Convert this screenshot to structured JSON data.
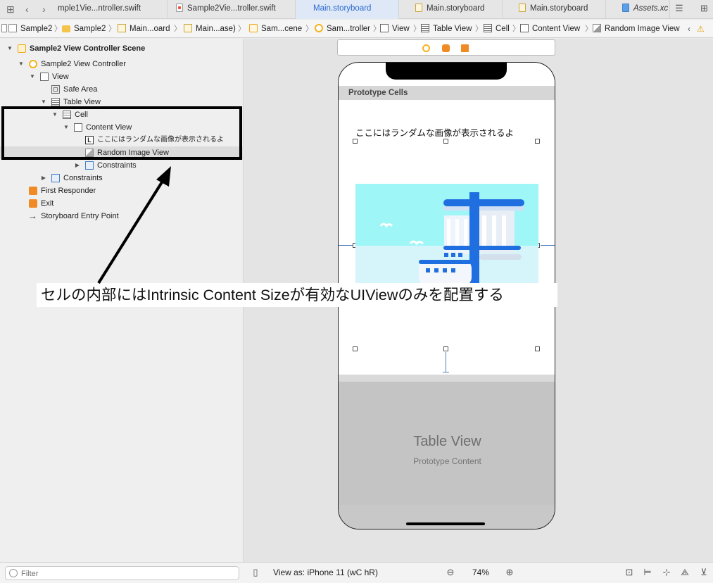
{
  "tabs": [
    {
      "label": "mple1Vie...ntroller.swift",
      "icon": "swift-file-icon",
      "active": false
    },
    {
      "label": "Sample2Vie...troller.swift",
      "icon": "swift-file-icon",
      "active": false
    },
    {
      "label": "Main.storyboard",
      "icon": "storyboard-file-icon",
      "active": true
    },
    {
      "label": "Main.storyboard",
      "icon": "storyboard-file-icon",
      "active": false
    },
    {
      "label": "Main.storyboard",
      "icon": "storyboard-file-icon",
      "active": false
    },
    {
      "label": "Assets.xc",
      "icon": "assets-catalog-icon",
      "active": false
    }
  ],
  "jumpbar": {
    "crumbs": [
      "Sample2",
      "Sample2",
      "Main...oard",
      "Main...ase)",
      "Sam...cene",
      "Sam...troller",
      "View",
      "Table View",
      "Cell",
      "Content View",
      "Random Image View"
    ]
  },
  "outline": {
    "scene": "Sample2 View Controller Scene",
    "vc": "Sample2 View Controller",
    "view": "View",
    "safe_area": "Safe Area",
    "table_view": "Table View",
    "cell": "Cell",
    "content_view": "Content View",
    "label": "ここにはランダムな画像が表示されるよ",
    "image_view": "Random Image View",
    "constraints_inner": "Constraints",
    "constraints_outer": "Constraints",
    "first_responder": "First Responder",
    "exit": "Exit",
    "entry_point": "Storyboard Entry Point"
  },
  "canvas": {
    "prototype_cells": "Prototype Cells",
    "cell_label": "ここにはランダムな画像が表示されるよ",
    "tv_title": "Table View",
    "tv_subtitle": "Prototype Content"
  },
  "annotation": "セルの内部にはIntrinsic Content Sizeが有効なUIViewのみを配置する",
  "bottom": {
    "filter_placeholder": "Filter",
    "view_as": "View as: iPhone 11 (wC hR)",
    "zoom": "74%"
  },
  "colors": {
    "accent": "#2a6ad1",
    "canvas_bg": "#e4e4e4",
    "image_sky": "#9ff6f6",
    "building_blue": "#1f6fe0"
  }
}
